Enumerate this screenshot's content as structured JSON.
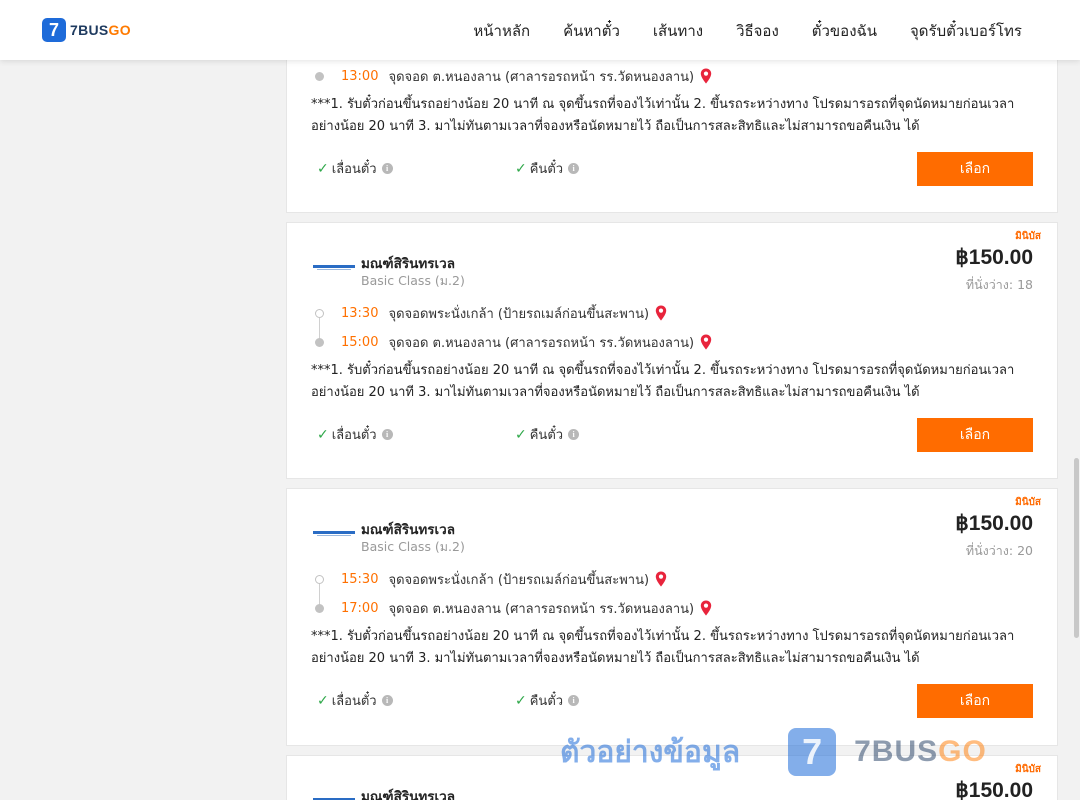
{
  "header": {
    "logo_mark": "7",
    "logo_text_a": "7BUS",
    "logo_text_b": "GO",
    "nav": [
      "หน้าหลัก",
      "ค้นหาตั๋ว",
      "เส้นทาง",
      "วิธีจอง",
      "ตั๋วของฉัน",
      "จุดรับตั๋วเบอร์โทร"
    ]
  },
  "common": {
    "notice": "***1. รับตั๋วก่อนขึ้นรถอย่างน้อย 20 นาที ณ จุดขึ้นรถที่จองไว้เท่านั้น 2. ขึ้นรถระหว่างทาง โปรดมารอรถที่จุดนัดหมายก่อนเวลาอย่างน้อย 20 นาที 3. มาไม่ทันตามเวลาที่จองหรือนัดหมายไว้ ถือเป็นการสละสิทธิและไม่สามารถขอคืนเงิน ได้",
    "feature_change": "เลื่อนตั๋ว",
    "feature_refund": "คืนตั๋ว",
    "select_label": "เลือก",
    "seats_label": "ที่นั่งว่าง:"
  },
  "partial_card": {
    "arrive_time": "13:00",
    "arrive_stop": "จุดจอด ต.หนองลาน (ศาลารอรถหน้า รร.วัดหนองลาน)"
  },
  "cards": [
    {
      "tag": "มินิบัส",
      "operator": "มณฑ์สิรินทรเวล",
      "class": "Basic Class (ม.2)",
      "price": "฿150.00",
      "seats": "18",
      "depart_time": "13:30",
      "depart_stop": "จุดจอดพระนั่งเกล้า (ป้ายรถเมล์ก่อนขึ้นสะพาน)",
      "arrive_time": "15:00",
      "arrive_stop": "จุดจอด ต.หนองลาน (ศาลารอรถหน้า รร.วัดหนองลาน)"
    },
    {
      "tag": "มินิบัส",
      "operator": "มณฑ์สิรินทรเวล",
      "class": "Basic Class (ม.2)",
      "price": "฿150.00",
      "seats": "20",
      "depart_time": "15:30",
      "depart_stop": "จุดจอดพระนั่งเกล้า (ป้ายรถเมล์ก่อนขึ้นสะพาน)",
      "arrive_time": "17:00",
      "arrive_stop": "จุดจอด ต.หนองลาน (ศาลารอรถหน้า รร.วัดหนองลาน)"
    },
    {
      "tag": "มินิบัส",
      "operator": "มณฑ์สิรินทรเวล",
      "price": "฿150.00"
    }
  ],
  "watermark": {
    "text": "ตัวอย่างข้อมูล",
    "logo_mark": "7",
    "brand_a": "7BUS",
    "brand_b": "GO"
  },
  "colors": {
    "accent": "#ff6c00",
    "time": "#ff7000",
    "brand_blue": "#1e6bd9",
    "check_green": "#2fa84a",
    "pin_red": "#e8243c"
  }
}
